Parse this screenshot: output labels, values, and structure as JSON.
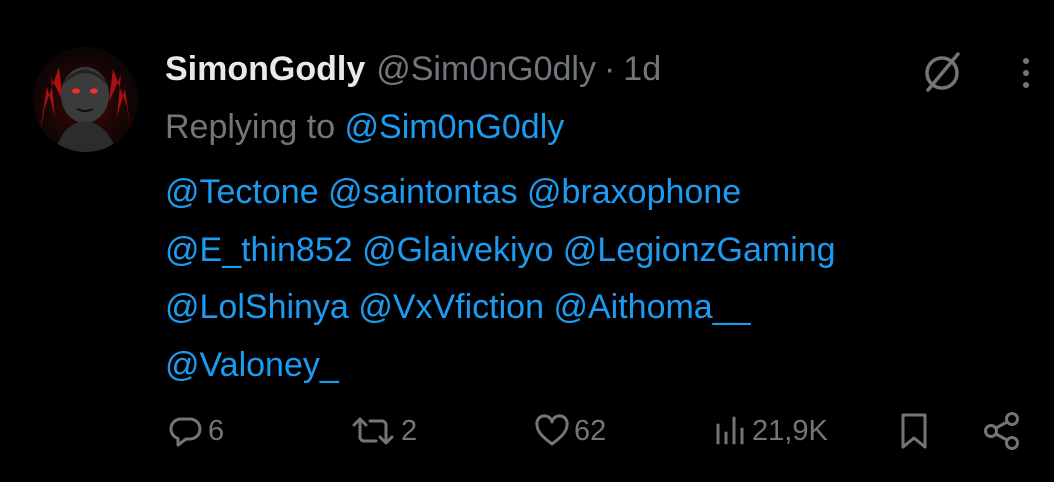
{
  "tweet": {
    "author": {
      "display_name": "SimonGodly",
      "handle": "@Sim0nG0dly",
      "avatar_icon": "avatar-image"
    },
    "separator": "·",
    "timestamp": "1d",
    "reply": {
      "prefix": "Replying to ",
      "mention": "@Sim0nG0dly"
    },
    "body_lines": [
      [
        "@Tectone",
        "@saintontas",
        "@braxophone"
      ],
      [
        "@E_thin852",
        "@Glaivekiyo",
        "@LegionzGaming"
      ],
      [
        "@LolShinya",
        "@VxVfiction",
        "@Aithoma__"
      ],
      [
        "@Valoney_"
      ]
    ],
    "icons": {
      "grok": "grok-icon",
      "more": "more-options-icon"
    },
    "actions": {
      "replies": "6",
      "retweets": "2",
      "likes": "62",
      "views": "21,9K"
    },
    "colors": {
      "background": "#000000",
      "primary_text": "#e7e9ea",
      "secondary_text": "#71767b",
      "accent": "#1d9bf0"
    }
  }
}
